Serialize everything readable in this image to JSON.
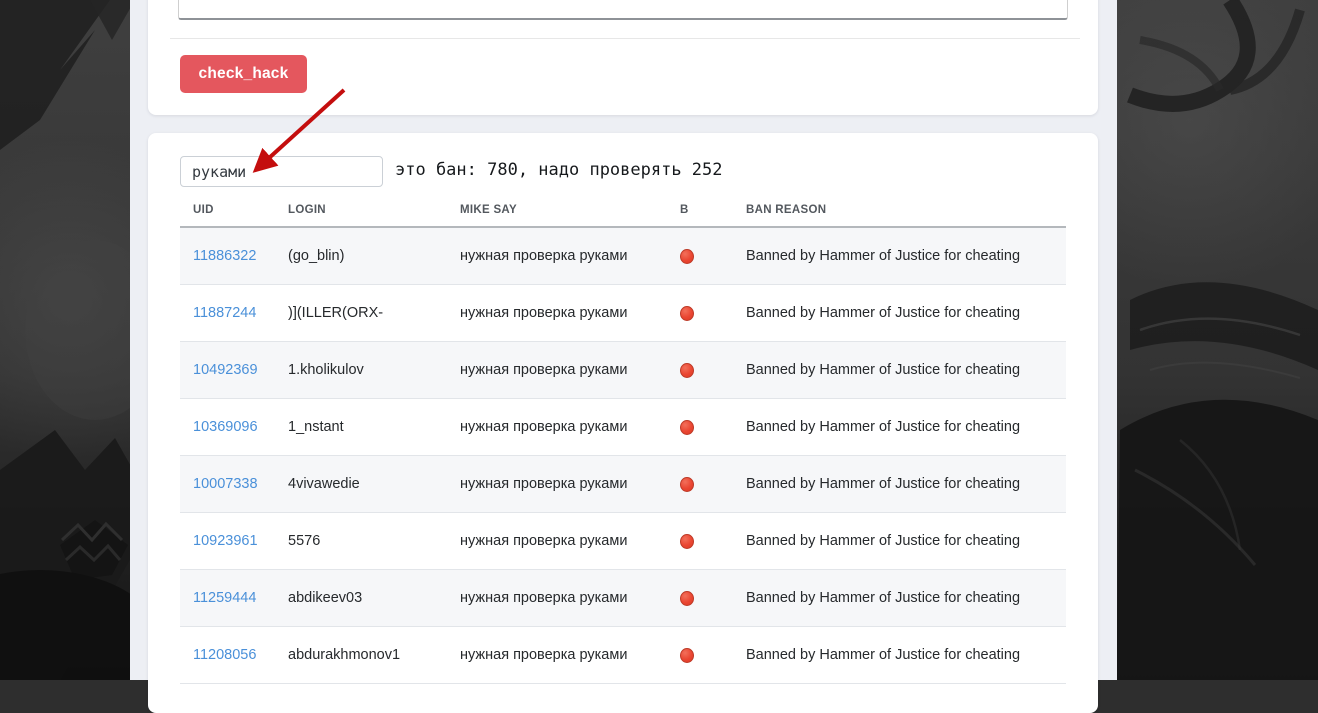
{
  "colors": {
    "accent_red": "#e4575e",
    "arrow_red": "#c40e0e",
    "link_blue": "#4a90d9",
    "status_red": "#ea4632",
    "strip_bg": "#edeff4"
  },
  "top_panel": {
    "button_label": "check_hack"
  },
  "results_panel": {
    "filter_input": {
      "value": "руками"
    },
    "summary_text": "это бан: 780, надо проверять 252",
    "table": {
      "headers": [
        "UID",
        "LOGIN",
        "MIKE SAY",
        "B",
        "BAN REASON"
      ],
      "status_icon": "red-circle",
      "rows": [
        {
          "uid": "11886322",
          "login": "(go_blin)",
          "mike_say": "нужная проверка руками",
          "ban_reason": "Banned by Hammer of Justice for cheating"
        },
        {
          "uid": "11887244",
          "login": ")](ILLER(ORX-",
          "mike_say": "нужная проверка руками",
          "ban_reason": "Banned by Hammer of Justice for cheating"
        },
        {
          "uid": "10492369",
          "login": "1.kholikulov",
          "mike_say": "нужная проверка руками",
          "ban_reason": "Banned by Hammer of Justice for cheating"
        },
        {
          "uid": "10369096",
          "login": "1_nstant",
          "mike_say": "нужная проверка руками",
          "ban_reason": "Banned by Hammer of Justice for cheating"
        },
        {
          "uid": "10007338",
          "login": "4vivawedie",
          "mike_say": "нужная проверка руками",
          "ban_reason": "Banned by Hammer of Justice for cheating"
        },
        {
          "uid": "10923961",
          "login": "5576",
          "mike_say": "нужная проверка руками",
          "ban_reason": "Banned by Hammer of Justice for cheating"
        },
        {
          "uid": "11259444",
          "login": "abdikeev03",
          "mike_say": "нужная проверка руками",
          "ban_reason": "Banned by Hammer of Justice for cheating"
        },
        {
          "uid": "11208056",
          "login": "abdurakhmonov1",
          "mike_say": "нужная проверка руками",
          "ban_reason": "Banned by Hammer of Justice for cheating"
        }
      ]
    }
  }
}
